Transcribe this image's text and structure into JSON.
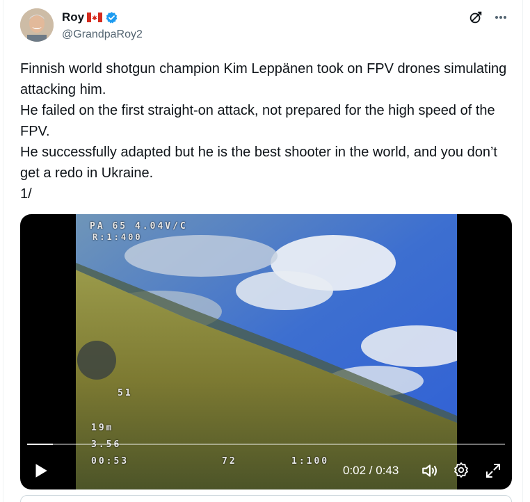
{
  "author": {
    "display_name": "Roy",
    "flag_icon": "canada-flag-icon",
    "verified_icon": "verified-badge-icon",
    "handle": "@GrandpaRoy2"
  },
  "actions": {
    "grok_icon": "grok-icon",
    "more_icon": "more-icon"
  },
  "tweet": {
    "lines": [
      "Finnish world shotgun champion Kim Leppänen took on FPV drones simulating attacking him.",
      "He failed on the first straight-on attack, not prepared for the high speed of the FPV.",
      "He successfully adapted but he is the best shooter in the world, and you don’t get a redo in Ukraine.",
      "1/"
    ]
  },
  "video": {
    "osd": {
      "top_status": "PA 65 4.04V/C",
      "top_sub": "R:1:400",
      "mid_value": "51",
      "alt": "19m",
      "dist": "3.56",
      "timer": "00:53",
      "speed": "72",
      "right_bottom": "1:100"
    },
    "progress_fraction": 0.054,
    "current_time": "0:02",
    "duration": "0:43",
    "time_text": "0:02 / 0:43",
    "play_icon": "play-icon",
    "volume_icon": "volume-icon",
    "settings_icon": "settings-icon",
    "fullscreen_icon": "fullscreen-icon"
  },
  "colors": {
    "text_primary": "#0f1419",
    "text_secondary": "#536471",
    "verified_blue": "#1d9bf0"
  }
}
